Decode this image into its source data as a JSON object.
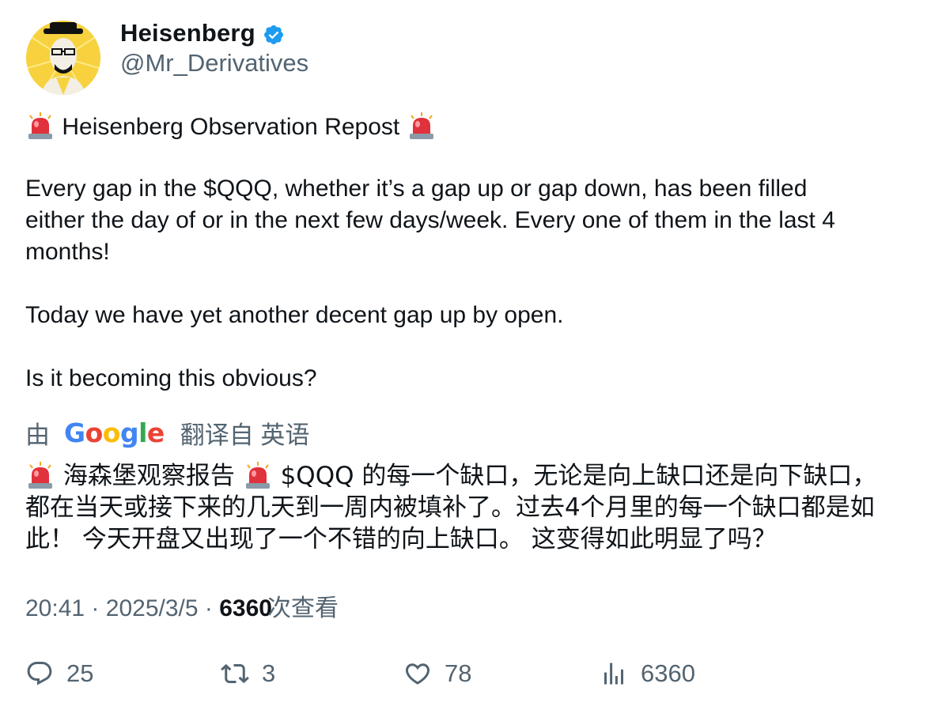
{
  "author": {
    "display_name": "Heisenberg",
    "handle": "@Mr_Derivatives",
    "verified": true
  },
  "tweet": {
    "lines": [
      {
        "text": "Heisenberg Observation Repost",
        "siren_before": true,
        "siren_after": true
      },
      {
        "text": "Every gap in the $QQQ, whether it’s a gap up or gap down, has been filled"
      },
      {
        "text": "either the day of or in the next few days/week. Every one of them in the last 4"
      },
      {
        "text": "months!"
      },
      {
        "text": "Today we have yet another decent gap up by open."
      },
      {
        "text": "Is it becoming this obvious?"
      }
    ]
  },
  "translation": {
    "prefix": "由",
    "provider": "Google",
    "suffix": "翻译自 英语",
    "line1_a": "海森堡观察报告",
    "line1_b": "$QQQ 的每一个缺口，无论是向上缺口还是向下缺口，",
    "line2": "都在当天或接下来的几天到一周内被填补了。过去4个月里的每一个缺口都是如",
    "line3": "此！ 今天开盘又出现了一个不错的向上缺口。 这变得如此明显了吗？"
  },
  "meta": {
    "time": "20:41",
    "separator": "·",
    "date": "2025/3/5",
    "views_count": "6360",
    "views_label": "次查看"
  },
  "actions": {
    "replies": "25",
    "reposts": "3",
    "likes": "78",
    "views": "6360"
  },
  "colors": {
    "text": "#0f1419",
    "secondary": "#536471",
    "verified": "#1d9bf0",
    "avatar_bg": "#f7d23e",
    "siren_red": "#e0323c"
  },
  "icons": [
    "verified-badge-icon",
    "siren-icon",
    "reply-icon",
    "repost-icon",
    "like-icon",
    "views-icon"
  ]
}
